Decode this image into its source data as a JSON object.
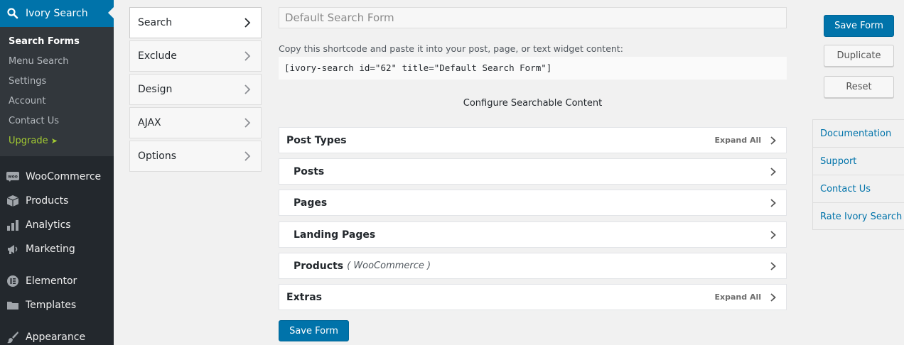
{
  "sidebar": {
    "current": "Ivory Search",
    "submenu": [
      "Search Forms",
      "Menu Search",
      "Settings",
      "Account",
      "Contact Us",
      "Upgrade"
    ],
    "upgrade_arrow": "➤",
    "items": [
      {
        "label": "WooCommerce",
        "icon": "woocommerce-icon",
        "glyph": "woo"
      },
      {
        "label": "Products",
        "icon": "products-box-icon",
        "glyph": ""
      },
      {
        "label": "Analytics",
        "icon": "analytics-bars-icon",
        "glyph": ""
      },
      {
        "label": "Marketing",
        "icon": "megaphone-icon",
        "glyph": ""
      },
      {
        "label": "Elementor",
        "icon": "elementor-icon",
        "glyph": ""
      },
      {
        "label": "Templates",
        "icon": "folder-icon",
        "glyph": ""
      },
      {
        "label": "Appearance",
        "icon": "paintbrush-icon",
        "glyph": ""
      }
    ]
  },
  "tabs": [
    "Search",
    "Exclude",
    "Design",
    "AJAX",
    "Options"
  ],
  "form": {
    "title_value": "Default Search Form",
    "shortcode_hint": "Copy this shortcode and paste it into your post, page, or text widget content:",
    "shortcode": "[ivory-search id=\"62\" title=\"Default Search Form\"]",
    "section_title": "Configure Searchable Content",
    "expand_all": "Expand All",
    "accordions": [
      {
        "label": "Post Types",
        "note": ""
      },
      {
        "label": "Posts",
        "note": ""
      },
      {
        "label": "Pages",
        "note": ""
      },
      {
        "label": "Landing Pages",
        "note": ""
      },
      {
        "label": "Products",
        "note": "( WooCommerce )"
      },
      {
        "label": "Extras",
        "note": ""
      }
    ],
    "save_bottom": "Save Form"
  },
  "actions": {
    "save": "Save Form",
    "duplicate": "Duplicate",
    "reset": "Reset"
  },
  "help_links": [
    "Documentation",
    "Support",
    "Contact Us",
    "Rate Ivory Search"
  ],
  "colors": {
    "admin_bar": "#23282d",
    "accent": "#0073aa",
    "upgrade": "#a4cc32"
  }
}
